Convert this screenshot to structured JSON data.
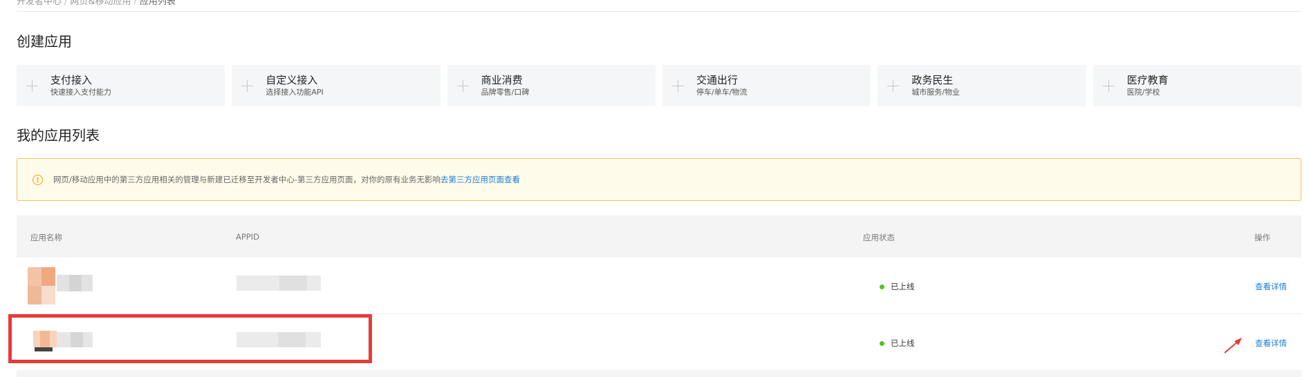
{
  "breadcrumb": {
    "items": [
      "开发者中心",
      "网页&移动应用"
    ],
    "current": "应用列表"
  },
  "create_section": {
    "title": "创建应用",
    "cards": [
      {
        "title": "支付接入",
        "subtitle": "快速接入支付能力"
      },
      {
        "title": "自定义接入",
        "subtitle": "选择接入功能API"
      },
      {
        "title": "商业消费",
        "subtitle": "品牌零售/口碑"
      },
      {
        "title": "交通出行",
        "subtitle": "停车/单车/物流"
      },
      {
        "title": "政务民生",
        "subtitle": "城市服务/物业"
      },
      {
        "title": "医疗教育",
        "subtitle": "医院/学校"
      }
    ]
  },
  "app_list": {
    "title": "我的应用列表",
    "notice": {
      "text": "网页/移动应用中的第三方应用相关的管理与新建已迁移至开发者中心-第三方应用页面，对你的原有业务无影响",
      "link": "去第三方应用页面查看",
      "icon": "warning-circle-icon"
    },
    "columns": {
      "name": "应用名称",
      "appid": "APPID",
      "status": "应用状态",
      "action": "操作"
    },
    "rows": [
      {
        "status": "已上线",
        "action": "查看详情"
      },
      {
        "status": "已上线",
        "action": "查看详情"
      }
    ]
  },
  "colors": {
    "accent_link": "#1a7fd6",
    "status_online": "#52c41a",
    "notice_border": "#f0c060",
    "highlight": "#e83a3a"
  }
}
